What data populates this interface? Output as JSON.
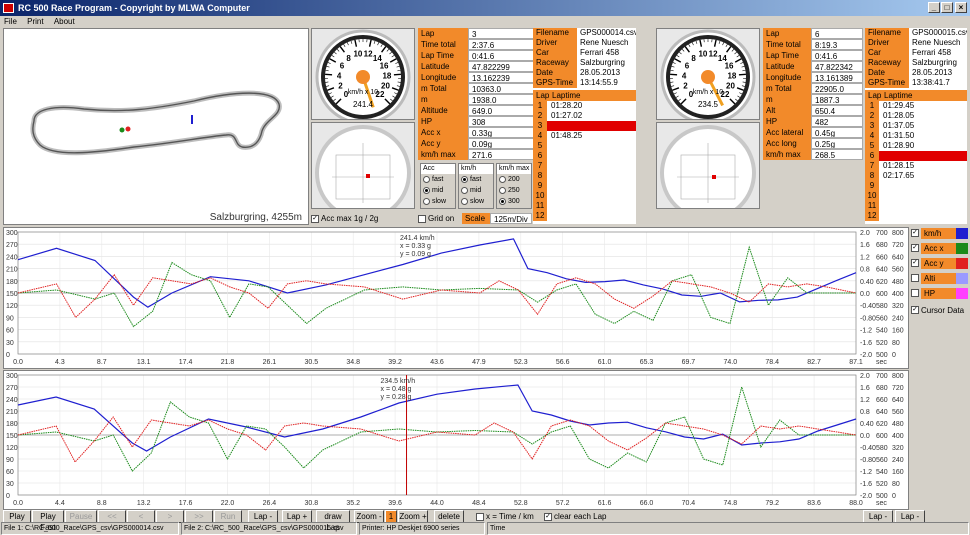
{
  "window": {
    "title": "RC 500 Race Program - Copyright by MLWA Computer",
    "min": "_",
    "max": "□",
    "close": "×"
  },
  "menu": [
    "File",
    "Print",
    "About"
  ],
  "track": {
    "caption": "Salzburgring, 4255m"
  },
  "gauge1": {
    "ticks": [
      "0",
      "2",
      "4",
      "6",
      "8",
      "10",
      "12",
      "14",
      "16",
      "18",
      "20",
      "22"
    ],
    "unit": "km/h x 10",
    "readout": "241.4"
  },
  "gauge2": {
    "ticks": [
      "0",
      "2",
      "4",
      "6",
      "8",
      "10",
      "12",
      "14",
      "16",
      "18",
      "20",
      "22"
    ],
    "unit": "km/h x 10",
    "readout": "234.5"
  },
  "data1": {
    "rows": [
      [
        "Lap",
        "3"
      ],
      [
        "Time total",
        "2:37.6"
      ],
      [
        "Lap Time",
        "0:41.6"
      ],
      [
        "Latitude",
        "47.822299"
      ],
      [
        "Longitude",
        "13.162239"
      ],
      [
        "m Total",
        "10363.0"
      ],
      [
        "m",
        "1938.0"
      ],
      [
        "Altitude",
        "649.0"
      ],
      [
        "HP",
        "308"
      ],
      [
        "Acc x",
        "0.33g"
      ],
      [
        "Acc y",
        "0.09g"
      ],
      [
        "km/h max",
        "271.6"
      ]
    ]
  },
  "data2": {
    "rows": [
      [
        "Lap",
        "6"
      ],
      [
        "Time total",
        "8:19.3"
      ],
      [
        "Lap Time",
        "0:41.6"
      ],
      [
        "Latitude",
        "47.822342"
      ],
      [
        "Longitude",
        "13.161389"
      ],
      [
        "m Total",
        "22905.0"
      ],
      [
        "m",
        "1887.3"
      ],
      [
        "Alt",
        "650.4"
      ],
      [
        "HP",
        "482"
      ],
      [
        "Acc lateral",
        "0.45g"
      ],
      [
        "Acc long",
        "0.25g"
      ],
      [
        "km/h max",
        "268.5"
      ]
    ]
  },
  "file1": {
    "rows": [
      [
        "Filename",
        "GPS000014.csv"
      ],
      [
        "Driver",
        "Rene Nuesch"
      ],
      [
        "Car",
        "Ferrari 458"
      ],
      [
        "Raceway",
        "Salzburgring"
      ],
      [
        "Date",
        "28.05.2013"
      ],
      [
        "GPS-Time",
        "13:14:55.9"
      ]
    ],
    "lap_header": [
      "Lap",
      "Laptime"
    ],
    "laps": [
      "01:28.20",
      "01:27.02",
      "",
      "01:48.25",
      "",
      "",
      "",
      "",
      "",
      "",
      "",
      ""
    ],
    "selected": 2
  },
  "file2": {
    "rows": [
      [
        "Filename",
        "GPS000015.csv"
      ],
      [
        "Driver",
        "Rene Nuesch"
      ],
      [
        "Car",
        "Ferrari 458"
      ],
      [
        "Raceway",
        "Salzburgring"
      ],
      [
        "Date",
        "28.05.2013"
      ],
      [
        "GPS-Time",
        "13:38:41.7"
      ]
    ],
    "lap_header": [
      "Lap",
      "Laptime"
    ],
    "laps": [
      "01:29.45",
      "01:28.05",
      "01:37.05",
      "01:31.50",
      "01:28.90",
      "",
      "01:28.15",
      "02:17.65",
      "",
      "",
      "",
      ""
    ],
    "selected": 5
  },
  "options": {
    "acc_max": "Acc max 1g / 2g",
    "grid_on": "Grid on",
    "scale_label": "Scale",
    "scale_value": "125m/Div",
    "groups": [
      {
        "title": "Acc",
        "items": [
          "fast",
          "mid",
          "slow"
        ],
        "selected": 1
      },
      {
        "title": "km/h",
        "items": [
          "fast",
          "mid",
          "slow"
        ],
        "selected": 0
      },
      {
        "title": "km/h max",
        "items": [
          "200",
          "250",
          "300"
        ],
        "selected": 2
      }
    ]
  },
  "legend": {
    "items": [
      {
        "label": "km/h",
        "color": "#1f1fd0",
        "checked": true
      },
      {
        "label": "Acc x",
        "color": "#1a8a1a",
        "checked": true
      },
      {
        "label": "Acc y",
        "color": "#e02020",
        "checked": true
      },
      {
        "label": "Alti",
        "color": "#9a9aff",
        "checked": false
      },
      {
        "label": "HP",
        "color": "#ff40ff",
        "checked": false
      }
    ],
    "cursor_data": "Cursor Data"
  },
  "chart_data": [
    {
      "type": "line",
      "xticks": [
        "0.0",
        "4.3",
        "8.7",
        "13.1",
        "17.4",
        "21.8",
        "26.1",
        "30.5",
        "34.8",
        "39.2",
        "43.6",
        "47.9",
        "52.3",
        "56.6",
        "61.0",
        "65.3",
        "69.7",
        "74.0",
        "78.4",
        "82.7",
        "87.1"
      ],
      "xunit": "sec",
      "yleft_ticks": [
        "300",
        "270",
        "240",
        "210",
        "180",
        "150",
        "120",
        "90",
        "60",
        "30",
        "0"
      ],
      "yacc_ticks": [
        "2.0",
        "1.6",
        "1.2",
        "0.8",
        "0.40",
        "0.0",
        "-0.40",
        "-0.80",
        "-1.2",
        "-1.6",
        "-2.0"
      ],
      "yalt_ticks": [
        "700",
        "680",
        "660",
        "640",
        "620",
        "600",
        "580",
        "560",
        "540",
        "520",
        "500"
      ],
      "yhp_ticks": [
        "800",
        "720",
        "640",
        "560",
        "480",
        "400",
        "320",
        "240",
        "160",
        "80",
        "0"
      ],
      "xlim": [
        0,
        87.1
      ],
      "cursor": {
        "speed": "241.4 km/h",
        "x": "x = 0.33 g",
        "y": "y = 0.09 g"
      },
      "series": [
        {
          "name": "km/h",
          "color": "#1f1fd0",
          "x": [
            0,
            4,
            8,
            12,
            13.5,
            16,
            20,
            24,
            28,
            32,
            36,
            40,
            44,
            48,
            51.5,
            53,
            55,
            57,
            59,
            61,
            63,
            65,
            67,
            69,
            71,
            73,
            75,
            77,
            79,
            81,
            83,
            85,
            87.1
          ],
          "values": [
            232,
            260,
            230,
            140,
            115,
            150,
            190,
            180,
            150,
            170,
            195,
            220,
            248,
            268,
            283,
            210,
            200,
            185,
            176,
            178,
            182,
            170,
            160,
            145,
            142,
            150,
            128,
            132,
            133,
            140,
            160,
            180,
            200
          ]
        },
        {
          "name": "Acc x",
          "color": "#1a8a1a",
          "x": [
            0,
            4,
            8,
            10,
            12,
            14,
            16,
            18,
            20,
            22,
            24,
            26,
            28,
            30,
            32,
            36,
            40,
            44,
            48,
            52,
            54,
            56,
            58,
            60,
            62,
            64,
            66,
            68,
            70,
            72,
            74,
            76,
            78,
            80,
            82,
            84,
            87.1
          ],
          "values": [
            0.0,
            0.1,
            -0.2,
            0.0,
            -1.1,
            -0.6,
            1.0,
            0.6,
            0.4,
            -0.8,
            0.3,
            0.2,
            -0.4,
            -1.0,
            -0.5,
            0.1,
            0.2,
            0.1,
            0.15,
            0.1,
            -0.3,
            0.1,
            0.3,
            -0.7,
            -1.0,
            -0.6,
            -0.9,
            0.4,
            0.6,
            -0.8,
            -1.0,
            1.5,
            -0.4,
            0.5,
            0.0,
            0.0,
            0.0
          ]
        },
        {
          "name": "Acc y",
          "color": "#e02020",
          "x": [
            0,
            4,
            6,
            8,
            10,
            12,
            14,
            16,
            18,
            20,
            22,
            24,
            26,
            28,
            30,
            32,
            36,
            40,
            44,
            48,
            50,
            52,
            54,
            56,
            58,
            60,
            62,
            64,
            66,
            68,
            70,
            72,
            74,
            76,
            78,
            80,
            82,
            84,
            87.1
          ],
          "values": [
            0.0,
            0.3,
            -0.8,
            -0.2,
            0.6,
            -0.4,
            0.5,
            0.4,
            0.3,
            0.5,
            0.2,
            0.0,
            -0.5,
            0.3,
            0.4,
            0.3,
            0.2,
            -0.2,
            0.1,
            0.0,
            0.4,
            0.1,
            -0.7,
            0.3,
            0.5,
            0.3,
            -0.2,
            -0.5,
            -0.1,
            0.4,
            0.3,
            0.2,
            0.0,
            -0.3,
            0.3,
            0.2,
            0.3,
            0.2,
            0.0
          ]
        }
      ]
    },
    {
      "type": "line",
      "xticks": [
        "0.0",
        "4.4",
        "8.8",
        "13.2",
        "17.6",
        "22.0",
        "26.4",
        "30.8",
        "35.2",
        "39.6",
        "44.0",
        "48.4",
        "52.8",
        "57.2",
        "61.6",
        "66.0",
        "70.4",
        "74.8",
        "79.2",
        "83.6",
        "88.0"
      ],
      "xunit": "sec",
      "yleft_ticks": [
        "300",
        "270",
        "240",
        "210",
        "180",
        "150",
        "120",
        "90",
        "60",
        "30",
        "0"
      ],
      "yacc_ticks": [
        "2.0",
        "1.6",
        "1.2",
        "0.8",
        "0.40",
        "0.0",
        "-0.40",
        "-0.80",
        "-1.2",
        "-1.6",
        "-2.0"
      ],
      "yalt_ticks": [
        "700",
        "680",
        "660",
        "640",
        "620",
        "600",
        "580",
        "560",
        "540",
        "520",
        "500"
      ],
      "yhp_ticks": [
        "800",
        "720",
        "640",
        "560",
        "480",
        "400",
        "320",
        "240",
        "160",
        "80",
        "0"
      ],
      "xlim": [
        0,
        88.0
      ],
      "cursor": {
        "speed": "234.5 km/h",
        "x": "x = 0.48 g",
        "y": "y = 0.28 g"
      },
      "cursor_x": 40.8,
      "series": [
        {
          "name": "km/h",
          "color": "#1f1fd0",
          "x": [
            0,
            4,
            8,
            12,
            13.5,
            16,
            20,
            24,
            28,
            32,
            36,
            40,
            44,
            48,
            52.5,
            54,
            56,
            58,
            60,
            62,
            64,
            66,
            68,
            70,
            72,
            74,
            76,
            78,
            80,
            82,
            84,
            86,
            88
          ],
          "values": [
            225,
            245,
            215,
            130,
            110,
            145,
            190,
            170,
            145,
            165,
            195,
            230,
            252,
            265,
            275,
            210,
            200,
            185,
            175,
            180,
            182,
            168,
            158,
            145,
            140,
            152,
            125,
            130,
            133,
            140,
            160,
            175,
            190
          ]
        },
        {
          "name": "Acc x",
          "color": "#1a8a1a",
          "x": [
            0,
            4,
            8,
            10,
            12,
            14,
            16,
            18,
            20,
            22,
            24,
            26,
            28,
            30,
            32,
            36,
            40,
            44,
            48,
            52,
            54,
            56,
            58,
            60,
            62,
            64,
            66,
            68,
            70,
            72,
            74,
            76,
            78,
            80,
            82,
            84,
            88
          ],
          "values": [
            0.0,
            0.1,
            -0.2,
            0.0,
            -1.2,
            -0.6,
            1.1,
            0.6,
            0.4,
            -0.8,
            0.3,
            0.2,
            -0.4,
            -1.1,
            -0.5,
            0.1,
            0.2,
            0.1,
            0.15,
            0.1,
            -0.3,
            0.1,
            0.3,
            -0.8,
            -1.1,
            -0.6,
            -0.9,
            0.4,
            0.6,
            -0.8,
            -1.0,
            1.6,
            -0.4,
            0.5,
            0.0,
            0.0,
            0.0
          ]
        },
        {
          "name": "Acc y",
          "color": "#e02020",
          "x": [
            0,
            4,
            6,
            8,
            10,
            12,
            14,
            16,
            18,
            20,
            22,
            24,
            26,
            28,
            30,
            32,
            36,
            40,
            44,
            48,
            50,
            52,
            54,
            56,
            58,
            60,
            62,
            64,
            66,
            68,
            70,
            72,
            74,
            76,
            78,
            80,
            82,
            84,
            88
          ],
          "values": [
            0.0,
            0.3,
            -0.9,
            -0.2,
            0.6,
            -0.4,
            0.5,
            0.4,
            0.3,
            0.5,
            0.2,
            0.0,
            -0.5,
            0.3,
            0.4,
            0.3,
            0.2,
            -0.2,
            0.1,
            0.0,
            0.4,
            0.1,
            -0.8,
            0.3,
            0.5,
            0.3,
            -0.2,
            -0.5,
            -0.1,
            0.4,
            0.3,
            0.2,
            0.0,
            -0.3,
            0.3,
            0.2,
            0.3,
            0.2,
            0.0
          ]
        }
      ]
    }
  ],
  "toolbar": {
    "buttons": [
      "Play",
      "Play Fast",
      "Pause",
      "<<",
      "<",
      ">",
      ">>",
      "Run",
      "Lap -",
      "Lap +",
      "draw Lap",
      "Zoom -",
      "1",
      "Zoom +",
      "delete"
    ],
    "disabled": [
      false,
      false,
      true,
      true,
      true,
      true,
      true,
      true,
      false,
      false,
      false,
      false,
      false,
      false,
      false
    ],
    "x_time_km": "x = Time / km",
    "clear_each_lap": "clear each Lap",
    "lap_minus": "Lap -",
    "lap_minus2": "Lap -"
  },
  "statusbar": [
    "File 1: C:\\RC_500_Race\\GPS_csv\\GPS000014.csv",
    "File 2: C:\\RC_500_Race\\GPS_csv\\GPS000015.csv",
    "Printer: HP Deskjet 6900 series",
    "Time"
  ]
}
